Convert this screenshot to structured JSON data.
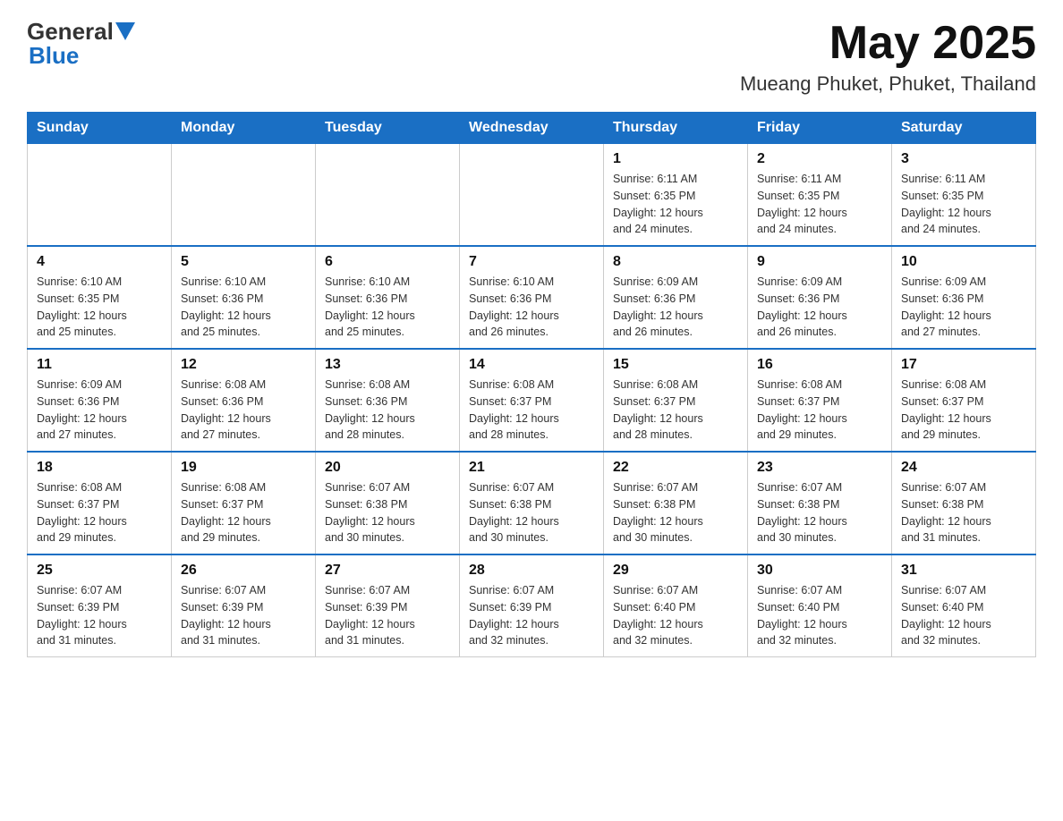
{
  "header": {
    "logo_general": "General",
    "logo_blue": "Blue",
    "month_year": "May 2025",
    "location": "Mueang Phuket, Phuket, Thailand"
  },
  "days_of_week": [
    "Sunday",
    "Monday",
    "Tuesday",
    "Wednesday",
    "Thursday",
    "Friday",
    "Saturday"
  ],
  "weeks": [
    {
      "days": [
        {
          "num": "",
          "info": ""
        },
        {
          "num": "",
          "info": ""
        },
        {
          "num": "",
          "info": ""
        },
        {
          "num": "",
          "info": ""
        },
        {
          "num": "1",
          "info": "Sunrise: 6:11 AM\nSunset: 6:35 PM\nDaylight: 12 hours\nand 24 minutes."
        },
        {
          "num": "2",
          "info": "Sunrise: 6:11 AM\nSunset: 6:35 PM\nDaylight: 12 hours\nand 24 minutes."
        },
        {
          "num": "3",
          "info": "Sunrise: 6:11 AM\nSunset: 6:35 PM\nDaylight: 12 hours\nand 24 minutes."
        }
      ]
    },
    {
      "days": [
        {
          "num": "4",
          "info": "Sunrise: 6:10 AM\nSunset: 6:35 PM\nDaylight: 12 hours\nand 25 minutes."
        },
        {
          "num": "5",
          "info": "Sunrise: 6:10 AM\nSunset: 6:36 PM\nDaylight: 12 hours\nand 25 minutes."
        },
        {
          "num": "6",
          "info": "Sunrise: 6:10 AM\nSunset: 6:36 PM\nDaylight: 12 hours\nand 25 minutes."
        },
        {
          "num": "7",
          "info": "Sunrise: 6:10 AM\nSunset: 6:36 PM\nDaylight: 12 hours\nand 26 minutes."
        },
        {
          "num": "8",
          "info": "Sunrise: 6:09 AM\nSunset: 6:36 PM\nDaylight: 12 hours\nand 26 minutes."
        },
        {
          "num": "9",
          "info": "Sunrise: 6:09 AM\nSunset: 6:36 PM\nDaylight: 12 hours\nand 26 minutes."
        },
        {
          "num": "10",
          "info": "Sunrise: 6:09 AM\nSunset: 6:36 PM\nDaylight: 12 hours\nand 27 minutes."
        }
      ]
    },
    {
      "days": [
        {
          "num": "11",
          "info": "Sunrise: 6:09 AM\nSunset: 6:36 PM\nDaylight: 12 hours\nand 27 minutes."
        },
        {
          "num": "12",
          "info": "Sunrise: 6:08 AM\nSunset: 6:36 PM\nDaylight: 12 hours\nand 27 minutes."
        },
        {
          "num": "13",
          "info": "Sunrise: 6:08 AM\nSunset: 6:36 PM\nDaylight: 12 hours\nand 28 minutes."
        },
        {
          "num": "14",
          "info": "Sunrise: 6:08 AM\nSunset: 6:37 PM\nDaylight: 12 hours\nand 28 minutes."
        },
        {
          "num": "15",
          "info": "Sunrise: 6:08 AM\nSunset: 6:37 PM\nDaylight: 12 hours\nand 28 minutes."
        },
        {
          "num": "16",
          "info": "Sunrise: 6:08 AM\nSunset: 6:37 PM\nDaylight: 12 hours\nand 29 minutes."
        },
        {
          "num": "17",
          "info": "Sunrise: 6:08 AM\nSunset: 6:37 PM\nDaylight: 12 hours\nand 29 minutes."
        }
      ]
    },
    {
      "days": [
        {
          "num": "18",
          "info": "Sunrise: 6:08 AM\nSunset: 6:37 PM\nDaylight: 12 hours\nand 29 minutes."
        },
        {
          "num": "19",
          "info": "Sunrise: 6:08 AM\nSunset: 6:37 PM\nDaylight: 12 hours\nand 29 minutes."
        },
        {
          "num": "20",
          "info": "Sunrise: 6:07 AM\nSunset: 6:38 PM\nDaylight: 12 hours\nand 30 minutes."
        },
        {
          "num": "21",
          "info": "Sunrise: 6:07 AM\nSunset: 6:38 PM\nDaylight: 12 hours\nand 30 minutes."
        },
        {
          "num": "22",
          "info": "Sunrise: 6:07 AM\nSunset: 6:38 PM\nDaylight: 12 hours\nand 30 minutes."
        },
        {
          "num": "23",
          "info": "Sunrise: 6:07 AM\nSunset: 6:38 PM\nDaylight: 12 hours\nand 30 minutes."
        },
        {
          "num": "24",
          "info": "Sunrise: 6:07 AM\nSunset: 6:38 PM\nDaylight: 12 hours\nand 31 minutes."
        }
      ]
    },
    {
      "days": [
        {
          "num": "25",
          "info": "Sunrise: 6:07 AM\nSunset: 6:39 PM\nDaylight: 12 hours\nand 31 minutes."
        },
        {
          "num": "26",
          "info": "Sunrise: 6:07 AM\nSunset: 6:39 PM\nDaylight: 12 hours\nand 31 minutes."
        },
        {
          "num": "27",
          "info": "Sunrise: 6:07 AM\nSunset: 6:39 PM\nDaylight: 12 hours\nand 31 minutes."
        },
        {
          "num": "28",
          "info": "Sunrise: 6:07 AM\nSunset: 6:39 PM\nDaylight: 12 hours\nand 32 minutes."
        },
        {
          "num": "29",
          "info": "Sunrise: 6:07 AM\nSunset: 6:40 PM\nDaylight: 12 hours\nand 32 minutes."
        },
        {
          "num": "30",
          "info": "Sunrise: 6:07 AM\nSunset: 6:40 PM\nDaylight: 12 hours\nand 32 minutes."
        },
        {
          "num": "31",
          "info": "Sunrise: 6:07 AM\nSunset: 6:40 PM\nDaylight: 12 hours\nand 32 minutes."
        }
      ]
    }
  ]
}
